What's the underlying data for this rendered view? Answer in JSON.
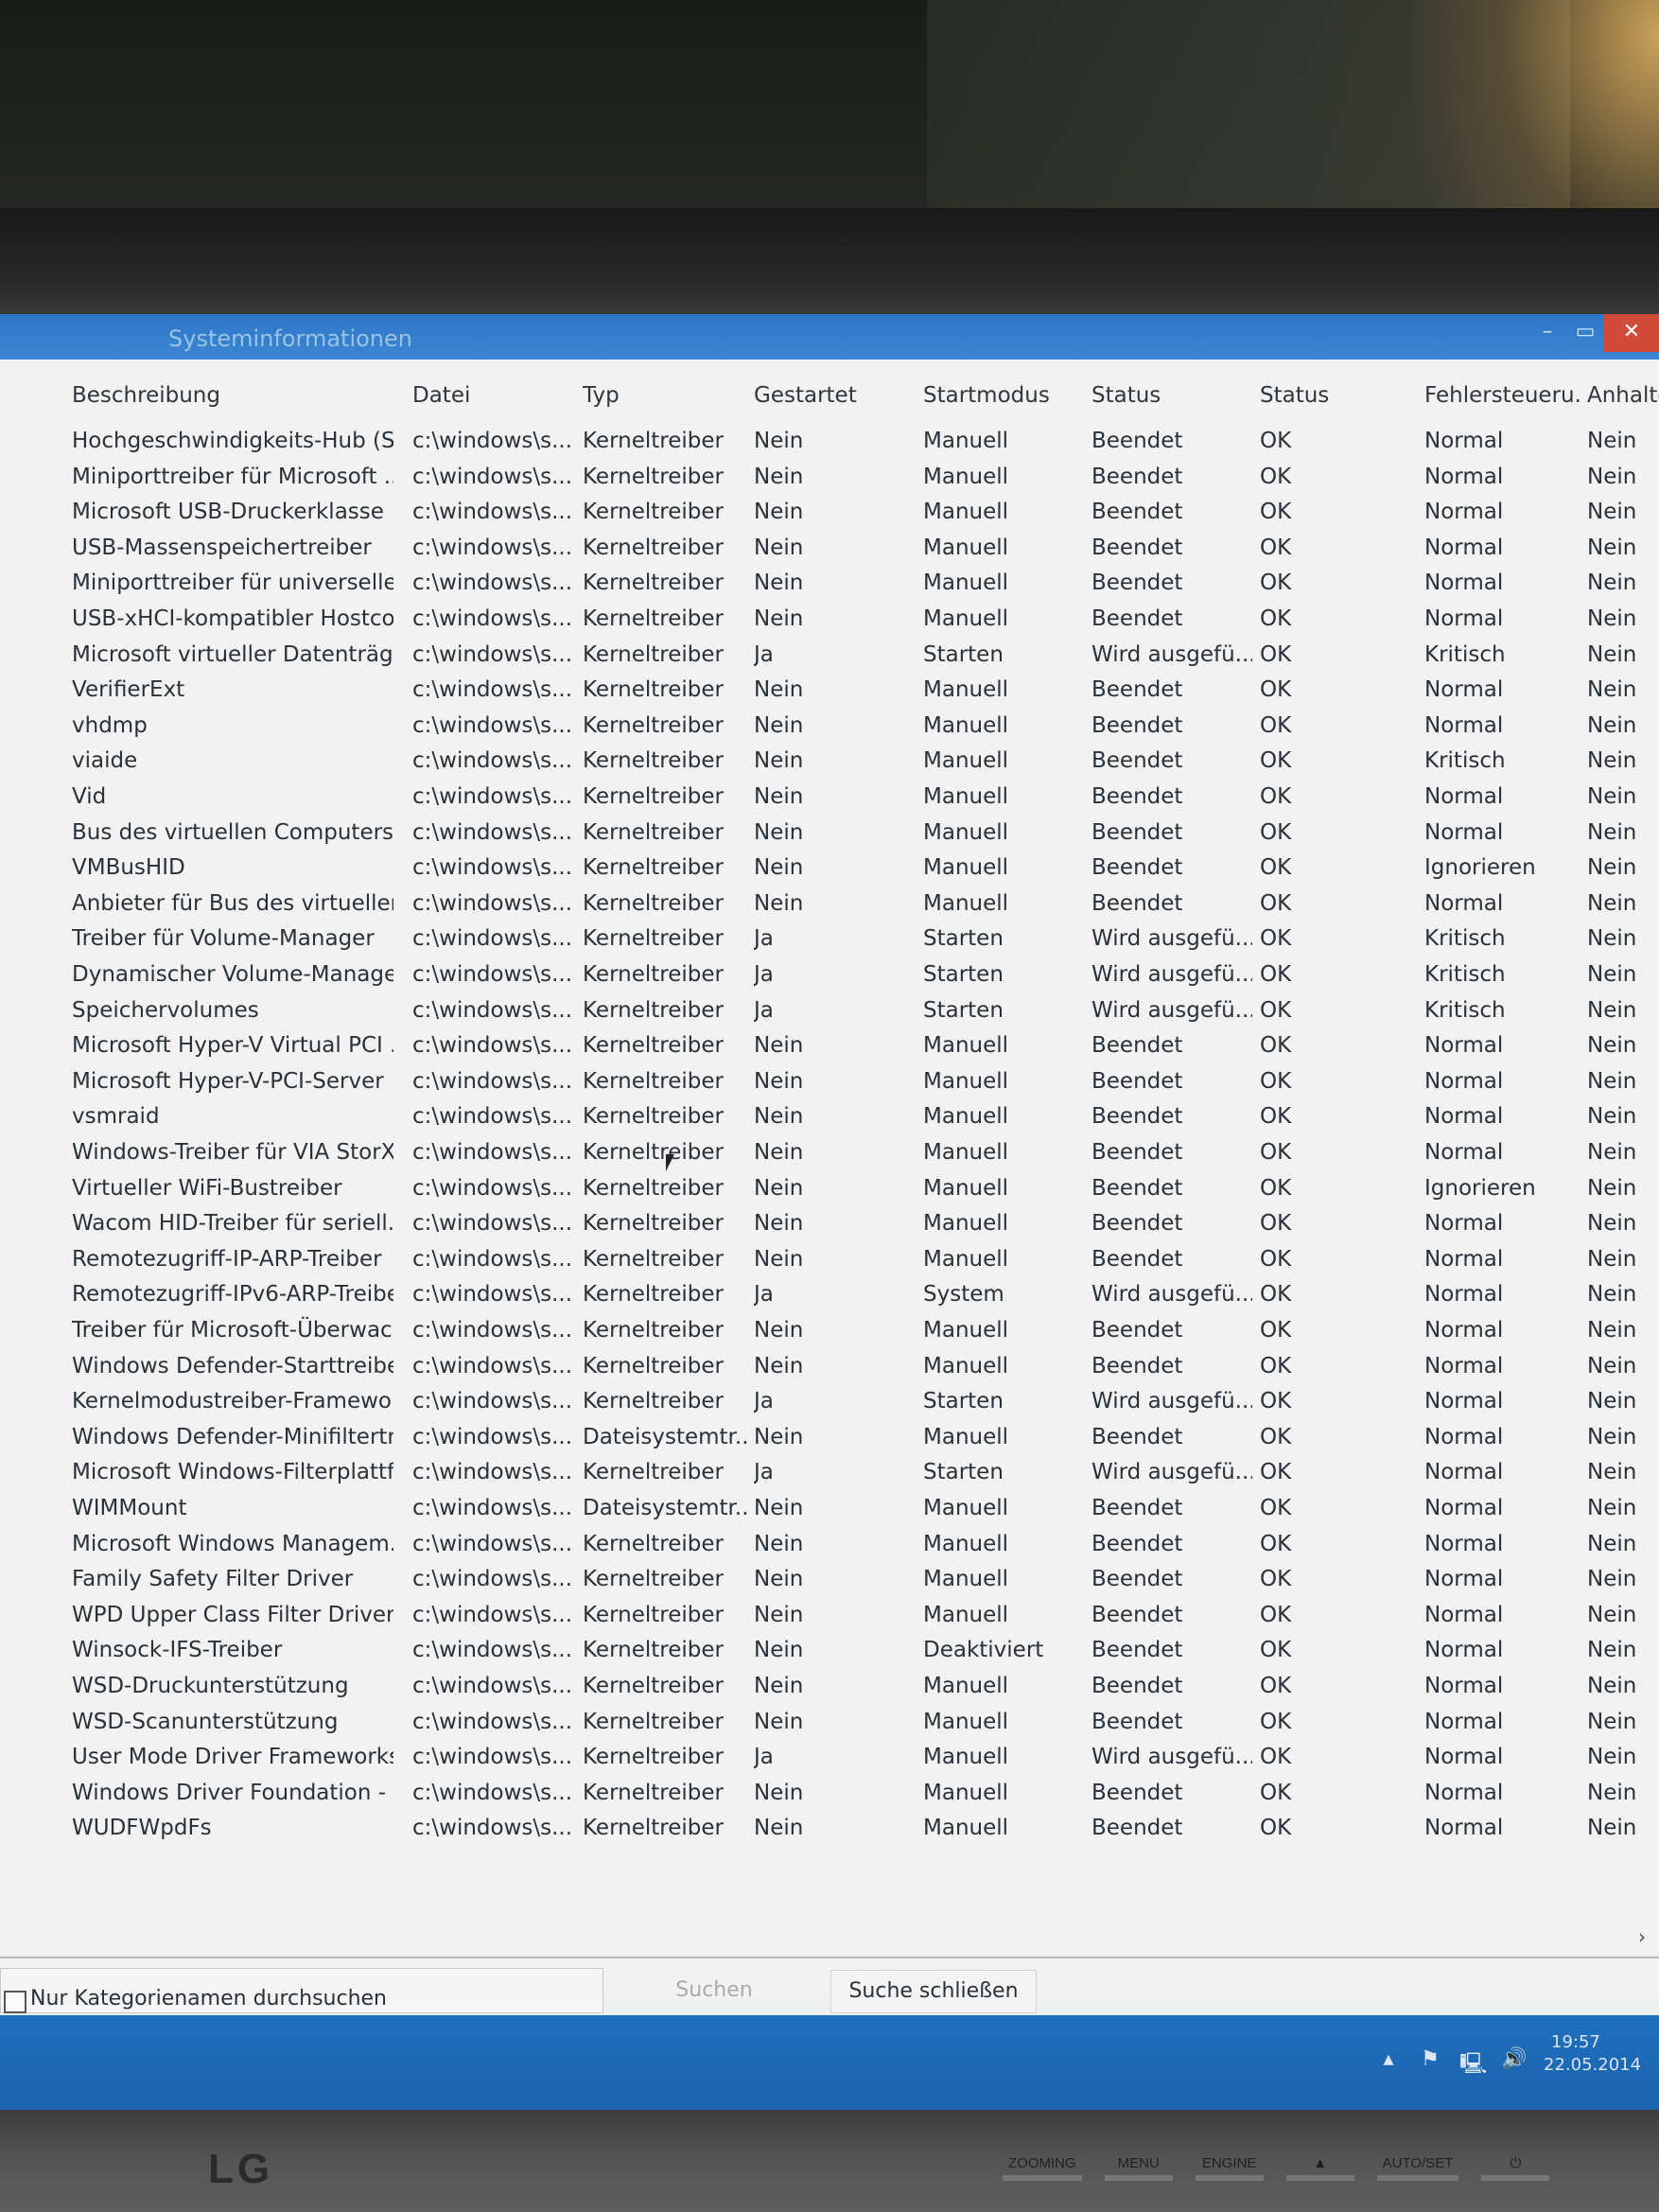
{
  "window": {
    "title": "Systeminformationen",
    "minimize_glyph": "–",
    "maximize_glyph": "▭",
    "close_glyph": "✕"
  },
  "columns": [
    "Beschreibung",
    "Datei",
    "Typ",
    "Gestartet",
    "Startmodus",
    "Status",
    "Status",
    "Fehlersteueru...",
    "Anhalte"
  ],
  "rows": [
    [
      "Hochgeschwindigkeits-Hub (Su...",
      "c:\\windows\\s...",
      "Kerneltreiber",
      "Nein",
      "Manuell",
      "Beendet",
      "OK",
      "Normal",
      "Nein"
    ],
    [
      "Miniporttreiber für Microsoft ...",
      "c:\\windows\\s...",
      "Kerneltreiber",
      "Nein",
      "Manuell",
      "Beendet",
      "OK",
      "Normal",
      "Nein"
    ],
    [
      "Microsoft USB-Druckerklasse",
      "c:\\windows\\s...",
      "Kerneltreiber",
      "Nein",
      "Manuell",
      "Beendet",
      "OK",
      "Normal",
      "Nein"
    ],
    [
      "USB-Massenspeichertreiber",
      "c:\\windows\\s...",
      "Kerneltreiber",
      "Nein",
      "Manuell",
      "Beendet",
      "OK",
      "Normal",
      "Nein"
    ],
    [
      "Miniporttreiber für universelle...",
      "c:\\windows\\s...",
      "Kerneltreiber",
      "Nein",
      "Manuell",
      "Beendet",
      "OK",
      "Normal",
      "Nein"
    ],
    [
      "USB-xHCI-kompatibler Hostco...",
      "c:\\windows\\s...",
      "Kerneltreiber",
      "Nein",
      "Manuell",
      "Beendet",
      "OK",
      "Normal",
      "Nein"
    ],
    [
      "Microsoft virtueller Datenträge...",
      "c:\\windows\\s...",
      "Kerneltreiber",
      "Ja",
      "Starten",
      "Wird ausgefü...",
      "OK",
      "Kritisch",
      "Nein"
    ],
    [
      "VerifierExt",
      "c:\\windows\\s...",
      "Kerneltreiber",
      "Nein",
      "Manuell",
      "Beendet",
      "OK",
      "Normal",
      "Nein"
    ],
    [
      "vhdmp",
      "c:\\windows\\s...",
      "Kerneltreiber",
      "Nein",
      "Manuell",
      "Beendet",
      "OK",
      "Normal",
      "Nein"
    ],
    [
      "viaide",
      "c:\\windows\\s...",
      "Kerneltreiber",
      "Nein",
      "Manuell",
      "Beendet",
      "OK",
      "Kritisch",
      "Nein"
    ],
    [
      "Vid",
      "c:\\windows\\s...",
      "Kerneltreiber",
      "Nein",
      "Manuell",
      "Beendet",
      "OK",
      "Normal",
      "Nein"
    ],
    [
      "Bus des virtuellen Computers",
      "c:\\windows\\s...",
      "Kerneltreiber",
      "Nein",
      "Manuell",
      "Beendet",
      "OK",
      "Normal",
      "Nein"
    ],
    [
      "VMBusHID",
      "c:\\windows\\s...",
      "Kerneltreiber",
      "Nein",
      "Manuell",
      "Beendet",
      "OK",
      "Ignorieren",
      "Nein"
    ],
    [
      "Anbieter für Bus des virtuellen ...",
      "c:\\windows\\s...",
      "Kerneltreiber",
      "Nein",
      "Manuell",
      "Beendet",
      "OK",
      "Normal",
      "Nein"
    ],
    [
      "Treiber für Volume-Manager",
      "c:\\windows\\s...",
      "Kerneltreiber",
      "Ja",
      "Starten",
      "Wird ausgefü...",
      "OK",
      "Kritisch",
      "Nein"
    ],
    [
      "Dynamischer Volume-Manager",
      "c:\\windows\\s...",
      "Kerneltreiber",
      "Ja",
      "Starten",
      "Wird ausgefü...",
      "OK",
      "Kritisch",
      "Nein"
    ],
    [
      "Speichervolumes",
      "c:\\windows\\s...",
      "Kerneltreiber",
      "Ja",
      "Starten",
      "Wird ausgefü...",
      "OK",
      "Kritisch",
      "Nein"
    ],
    [
      "Microsoft Hyper-V Virtual PCI ...",
      "c:\\windows\\s...",
      "Kerneltreiber",
      "Nein",
      "Manuell",
      "Beendet",
      "OK",
      "Normal",
      "Nein"
    ],
    [
      "Microsoft Hyper-V-PCI-Server",
      "c:\\windows\\s...",
      "Kerneltreiber",
      "Nein",
      "Manuell",
      "Beendet",
      "OK",
      "Normal",
      "Nein"
    ],
    [
      "vsmraid",
      "c:\\windows\\s...",
      "Kerneltreiber",
      "Nein",
      "Manuell",
      "Beendet",
      "OK",
      "Normal",
      "Nein"
    ],
    [
      "Windows-Treiber für VIA StorX...",
      "c:\\windows\\s...",
      "Kerneltreiber",
      "Nein",
      "Manuell",
      "Beendet",
      "OK",
      "Normal",
      "Nein"
    ],
    [
      "Virtueller WiFi-Bustreiber",
      "c:\\windows\\s...",
      "Kerneltreiber",
      "Nein",
      "Manuell",
      "Beendet",
      "OK",
      "Ignorieren",
      "Nein"
    ],
    [
      "Wacom HID-Treiber für seriell...",
      "c:\\windows\\s...",
      "Kerneltreiber",
      "Nein",
      "Manuell",
      "Beendet",
      "OK",
      "Normal",
      "Nein"
    ],
    [
      "Remotezugriff-IP-ARP-Treiber",
      "c:\\windows\\s...",
      "Kerneltreiber",
      "Nein",
      "Manuell",
      "Beendet",
      "OK",
      "Normal",
      "Nein"
    ],
    [
      "Remotezugriff-IPv6-ARP-Treiber",
      "c:\\windows\\s...",
      "Kerneltreiber",
      "Ja",
      "System",
      "Wird ausgefü...",
      "OK",
      "Normal",
      "Nein"
    ],
    [
      "Treiber für Microsoft-Überwac...",
      "c:\\windows\\s...",
      "Kerneltreiber",
      "Nein",
      "Manuell",
      "Beendet",
      "OK",
      "Normal",
      "Nein"
    ],
    [
      "Windows Defender-Starttreiber",
      "c:\\windows\\s...",
      "Kerneltreiber",
      "Nein",
      "Manuell",
      "Beendet",
      "OK",
      "Normal",
      "Nein"
    ],
    [
      "Kernelmodustreiber-Framewor...",
      "c:\\windows\\s...",
      "Kerneltreiber",
      "Ja",
      "Starten",
      "Wird ausgefü...",
      "OK",
      "Normal",
      "Nein"
    ],
    [
      "Windows Defender-Minifiltertr...",
      "c:\\windows\\s...",
      "Dateisystemtr...",
      "Nein",
      "Manuell",
      "Beendet",
      "OK",
      "Normal",
      "Nein"
    ],
    [
      "Microsoft Windows-Filterplattf...",
      "c:\\windows\\s...",
      "Kerneltreiber",
      "Ja",
      "Starten",
      "Wird ausgefü...",
      "OK",
      "Normal",
      "Nein"
    ],
    [
      "WIMMount",
      "c:\\windows\\s...",
      "Dateisystemtr...",
      "Nein",
      "Manuell",
      "Beendet",
      "OK",
      "Normal",
      "Nein"
    ],
    [
      "Microsoft Windows Managem...",
      "c:\\windows\\s...",
      "Kerneltreiber",
      "Nein",
      "Manuell",
      "Beendet",
      "OK",
      "Normal",
      "Nein"
    ],
    [
      "Family Safety Filter Driver",
      "c:\\windows\\s...",
      "Kerneltreiber",
      "Nein",
      "Manuell",
      "Beendet",
      "OK",
      "Normal",
      "Nein"
    ],
    [
      "WPD Upper Class Filter Driver",
      "c:\\windows\\s...",
      "Kerneltreiber",
      "Nein",
      "Manuell",
      "Beendet",
      "OK",
      "Normal",
      "Nein"
    ],
    [
      "Winsock-IFS-Treiber",
      "c:\\windows\\s...",
      "Kerneltreiber",
      "Nein",
      "Deaktiviert",
      "Beendet",
      "OK",
      "Normal",
      "Nein"
    ],
    [
      "WSD-Druckunterstützung",
      "c:\\windows\\s...",
      "Kerneltreiber",
      "Nein",
      "Manuell",
      "Beendet",
      "OK",
      "Normal",
      "Nein"
    ],
    [
      "WSD-Scanunterstützung",
      "c:\\windows\\s...",
      "Kerneltreiber",
      "Nein",
      "Manuell",
      "Beendet",
      "OK",
      "Normal",
      "Nein"
    ],
    [
      "User Mode Driver Frameworks...",
      "c:\\windows\\s...",
      "Kerneltreiber",
      "Ja",
      "Manuell",
      "Wird ausgefü...",
      "OK",
      "Normal",
      "Nein"
    ],
    [
      "Windows Driver Foundation - ...",
      "c:\\windows\\s...",
      "Kerneltreiber",
      "Nein",
      "Manuell",
      "Beendet",
      "OK",
      "Normal",
      "Nein"
    ],
    [
      "WUDFWpdFs",
      "c:\\windows\\s...",
      "Kerneltreiber",
      "Nein",
      "Manuell",
      "Beendet",
      "OK",
      "Normal",
      "Nein"
    ]
  ],
  "search": {
    "input_value": "",
    "search_label": "Suchen",
    "close_label": "Suche schließen",
    "category_checkbox_label": "Nur Kategorienamen durchsuchen",
    "category_checkbox_checked": false
  },
  "scroll": {
    "right_arrow_glyph": "›"
  },
  "taskbar": {
    "tray_icons": [
      "show-hidden-icons",
      "action-center-flag-icon",
      "network-icon",
      "volume-icon"
    ],
    "tray_glyphs": [
      "▴",
      "⚑",
      "🖳",
      "🔊"
    ],
    "time": "19:57",
    "date": "22.05.2014"
  },
  "monitor": {
    "brand": "LG",
    "buttons": [
      "ZOOMING",
      "MENU",
      "ENGINE",
      "▲",
      "AUTO/SET",
      "⏻"
    ]
  },
  "colors": {
    "titlebar": "#2d78c8",
    "taskbar": "#1f6fbe",
    "close_button": "#d14a3a",
    "content_bg": "#f1f2f1",
    "text": "#2a3138"
  }
}
